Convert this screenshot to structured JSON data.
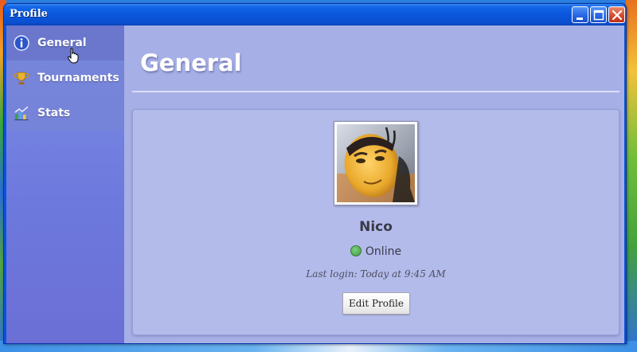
{
  "window": {
    "title": "Profile"
  },
  "sidebar": {
    "items": [
      {
        "label": "General",
        "icon": "info-icon",
        "active": true
      },
      {
        "label": "Tournaments",
        "icon": "trophy-icon",
        "active": false
      },
      {
        "label": "Stats",
        "icon": "chart-icon",
        "active": false
      }
    ]
  },
  "main": {
    "title": "General",
    "profile": {
      "avatar_icon": "avatar-image",
      "name": "Nico",
      "status": "Online",
      "status_color": "#4caf50",
      "last_login": "Last login: Today at 9:45 AM",
      "edit_button": "Edit Profile"
    }
  },
  "colors": {
    "titlebar": "#0a57dc",
    "sidebar": "#6d79dd",
    "content": "#a6b0e6"
  }
}
